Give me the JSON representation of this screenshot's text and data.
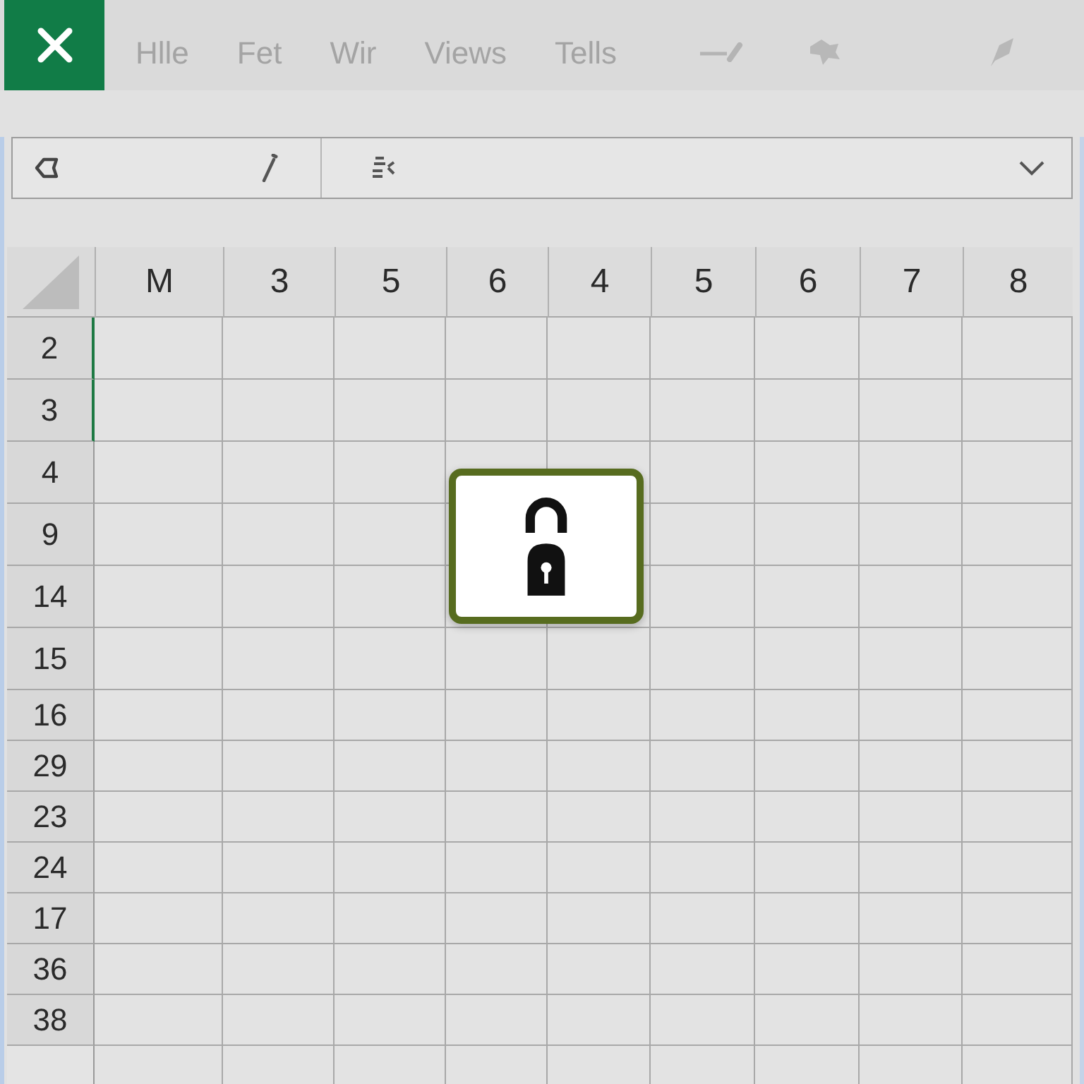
{
  "menu_bar": {
    "items": [
      "Hlle",
      "Fet",
      "Wir",
      "Views",
      "Tells"
    ]
  },
  "sheet": {
    "columns": [
      "M",
      "3",
      "5",
      "6",
      "4",
      "5",
      "6",
      "7",
      "8"
    ],
    "rows": [
      {
        "label": "2",
        "selected": true
      },
      {
        "label": "3",
        "selected": true
      },
      {
        "label": "4",
        "selected": false
      },
      {
        "label": "9",
        "selected": false
      },
      {
        "label": "14",
        "selected": false
      },
      {
        "label": "15",
        "selected": false
      },
      {
        "label": "16",
        "selected": false
      },
      {
        "label": "29",
        "selected": false
      },
      {
        "label": "23",
        "selected": false
      },
      {
        "label": "24",
        "selected": false
      },
      {
        "label": "17",
        "selected": false
      },
      {
        "label": "36",
        "selected": false
      },
      {
        "label": "38",
        "selected": false
      }
    ]
  }
}
